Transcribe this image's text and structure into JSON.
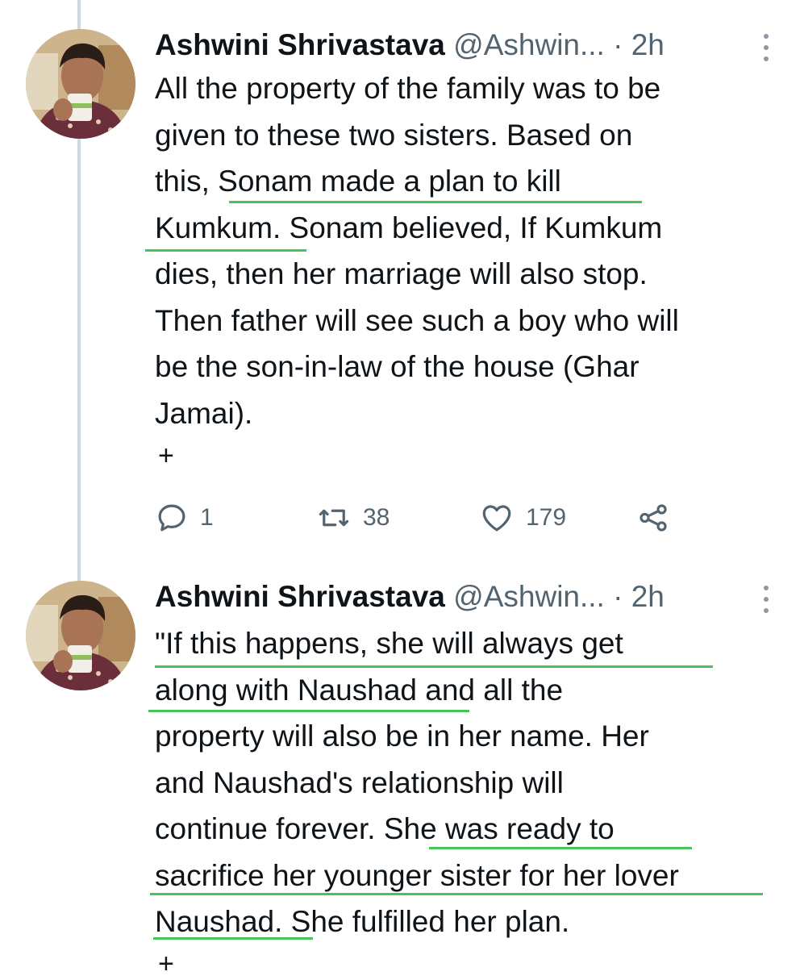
{
  "tweets": [
    {
      "author": "Ashwini Shrivastava",
      "handle": "@Ashwin...",
      "dot": "·",
      "time": "2h",
      "lines": [
        "All the property of the family was to be",
        "given to these two sisters. Based on",
        "this, Sonam made a plan to kill",
        "Kumkum. Sonam believed, If Kumkum",
        "dies, then her marriage will also stop.",
        "Then father will see such a boy who will",
        "be the son-in-law of the house (Ghar",
        "Jamai)."
      ],
      "expand": "+",
      "replies": "1",
      "retweets": "38",
      "likes": "179"
    },
    {
      "author": "Ashwini Shrivastava",
      "handle": "@Ashwin...",
      "dot": "·",
      "time": "2h",
      "lines": [
        "\"If this happens, she will always get",
        "along with Naushad and all the",
        "property will also be in her name. Her",
        "and Naushad's relationship will",
        "continue forever. She was ready to",
        "sacrifice her younger sister for her lover",
        "Naushad. She fulfilled her plan."
      ],
      "expand": "+"
    }
  ],
  "icons": [
    "more-icon",
    "reply-icon",
    "retweet-icon",
    "like-icon",
    "share-icon"
  ],
  "colors": {
    "highlight_underline": "#46c45a",
    "thread_line": "#cfd9de",
    "secondary_text": "#536471"
  }
}
